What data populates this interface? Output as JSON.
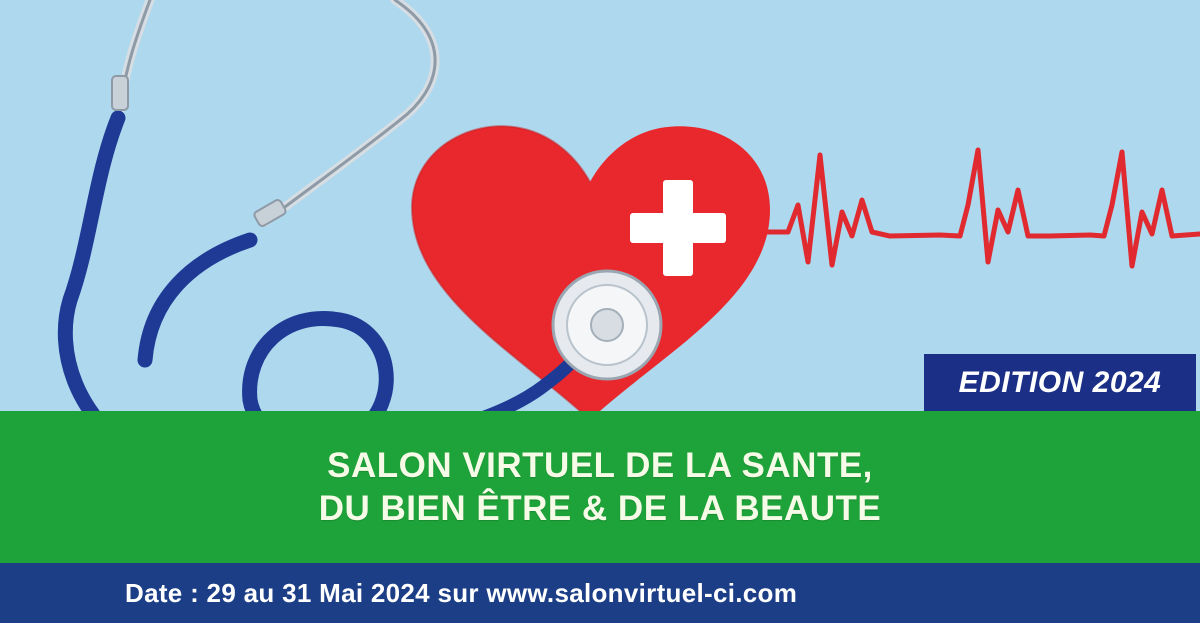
{
  "edition_badge": "EDITION 2024",
  "title": {
    "line1": "SALON VIRTUEL DE LA SANTE,",
    "line2": "DU BIEN ÊTRE & DE LA BEAUTE"
  },
  "footer": {
    "date_line": "Date : 29 au 31 Mai 2024 sur www.salonvirtuel-ci.com"
  },
  "colors": {
    "background": "#a9d6ee",
    "heart": "#e8282c",
    "ecg_line": "#e02a2f",
    "stethoscope_tube": "#1f3a94",
    "banner_green": "#1ea33a",
    "badge_navy": "#1c2f86",
    "footer_navy": "#1c3e86"
  },
  "icons": {
    "heart": "heart-with-cross-icon",
    "stethoscope": "stethoscope-icon",
    "ecg": "heartbeat-line-icon"
  }
}
